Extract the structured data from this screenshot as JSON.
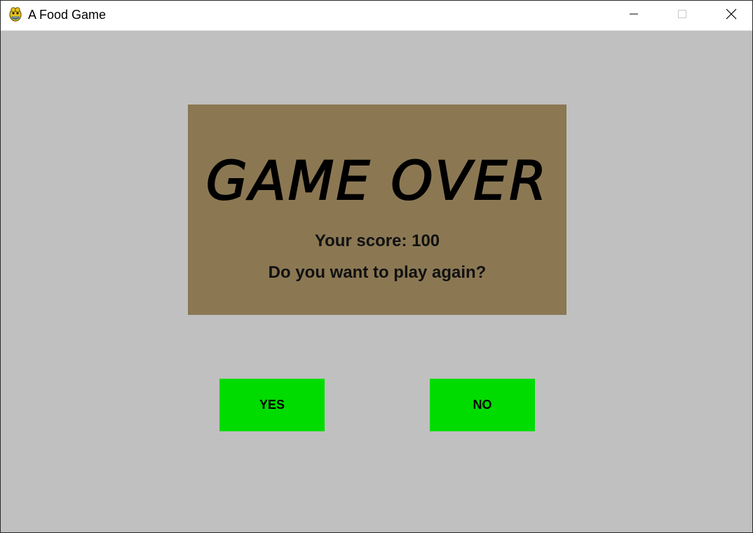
{
  "window": {
    "title": "A Food Game",
    "icon": "pygame-snake-icon",
    "controls": {
      "minimize_icon": "minimize-icon",
      "maximize_icon": "maximize-icon",
      "close_icon": "close-icon"
    }
  },
  "game": {
    "background_color": "#c0c0c0",
    "panel_color": "#8b7853",
    "heading": "GAME OVER",
    "score_text": "Your score: 100",
    "score_value": 100,
    "prompt": "Do you want to play again?",
    "buttons": {
      "yes_label": "YES",
      "no_label": "NO",
      "color": "#00dc00"
    }
  }
}
